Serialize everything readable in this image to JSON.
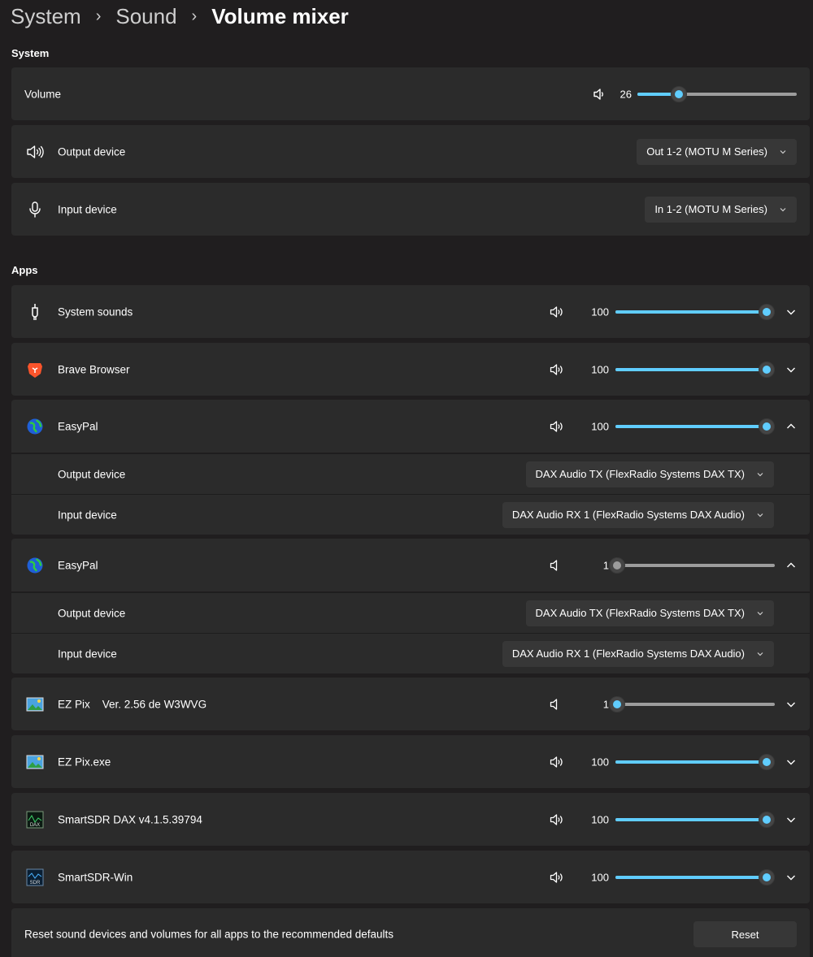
{
  "breadcrumb": {
    "items": [
      "System",
      "Sound"
    ],
    "current": "Volume mixer"
  },
  "system": {
    "title": "System",
    "volume": {
      "label": "Volume",
      "value": "26",
      "level": 0.26
    },
    "output": {
      "label": "Output device",
      "value": "Out 1-2 (MOTU M Series)"
    },
    "input": {
      "label": "Input device",
      "value": "In 1-2 (MOTU M Series)"
    }
  },
  "apps": {
    "title": "Apps",
    "items": [
      {
        "name": "System sounds",
        "value": "100",
        "level": 1.0,
        "icon": "system-sounds-icon"
      },
      {
        "name": "Brave Browser",
        "value": "100",
        "level": 1.0,
        "icon": "brave-browser-icon"
      },
      {
        "name": "EasyPal",
        "value": "100",
        "level": 1.0,
        "icon": "easypal-globe-icon",
        "output_label": "Output device",
        "output_value": "DAX Audio TX (FlexRadio Systems DAX TX)",
        "input_label": "Input device",
        "input_value": "DAX Audio RX 1 (FlexRadio Systems DAX Audio)"
      },
      {
        "name": "EasyPal",
        "value": "1",
        "level": 0.01,
        "icon": "easypal-globe-icon",
        "output_label": "Output device",
        "output_value": "DAX Audio TX (FlexRadio Systems DAX TX)",
        "input_label": "Input device",
        "input_value": "DAX Audio RX 1 (FlexRadio Systems DAX Audio)"
      },
      {
        "name": "EZ Pix    Ver. 2.56 de W3WVG",
        "value": "1",
        "level": 0.01,
        "icon": "ez-pix-icon"
      },
      {
        "name": "EZ Pix.exe",
        "value": "100",
        "level": 1.0,
        "icon": "ez-pix-icon"
      },
      {
        "name": "SmartSDR DAX v4.1.5.39794",
        "value": "100",
        "level": 1.0,
        "icon": "smartsdr-dax-icon",
        "icon_text": "DAX"
      },
      {
        "name": "SmartSDR-Win",
        "value": "100",
        "level": 1.0,
        "icon": "smartsdr-icon",
        "icon_text": "SDR"
      }
    ]
  },
  "reset": {
    "text": "Reset sound devices and volumes for all apps to the recommended defaults",
    "button": "Reset"
  },
  "colors": {
    "accent": "#60cdff",
    "card": "#2b2b2b",
    "background": "#201e1f"
  }
}
